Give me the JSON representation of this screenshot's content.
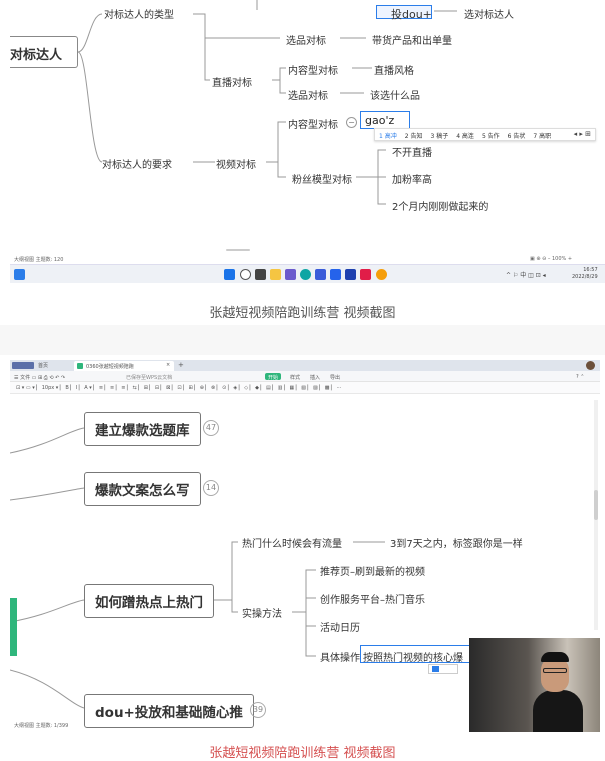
{
  "shot1": {
    "top_notice": "投dou+",
    "root_label": "对标达人",
    "branch_types": "对标达人的类型",
    "branch_requirements": "对标达人的要求",
    "live_benchmark": "直播对标",
    "video_benchmark": "视频对标",
    "content_benchmark_live": "内容型对标",
    "content_benchmark_video": "内容型对标",
    "product_benchmark_1": "选品对标",
    "product_benchmark_2": "选品对标",
    "fans_benchmark": "粉丝模型对标",
    "leaf_douplus": "投dou+",
    "leaf_choose_talent": "选对标达人",
    "leaf_goods_orders": "带货产品和出单量",
    "leaf_live_style": "直播风格",
    "leaf_what_to_sell": "该选什么品",
    "input_text": "gao'z",
    "ime_candidates": [
      "1 高冲",
      "2 告知",
      "3 稿子",
      "4 高连",
      "5 告作",
      "6 告状",
      "7 高职"
    ],
    "leaf_no_live": "不开直播",
    "leaf_high_fans_rate": "加粉率高",
    "leaf_two_months": "2个月内刚刚做起来的",
    "status_left": "大纲视图   主题数: 120",
    "status_zoom": "100%",
    "clock_time": "16:57",
    "clock_date": "2022/8/29"
  },
  "caption1": "张越短视频陪跑训练营 视频截图",
  "shot2": {
    "tab_home": "首页",
    "tab_doc": "0360张越短视频陪跑",
    "toolbar_hint": "已保存至WPS云文档",
    "menu_start": "开始",
    "menu_style": "样式",
    "menu_insert": "插入",
    "menu_export": "导出",
    "node_topic_lib": "建立爆款选题库",
    "badge_topic_lib": "47",
    "node_copywriting": "爆款文案怎么写",
    "badge_copywriting": "14",
    "node_hot_topic": "如何蹭热点上热门",
    "node_douplus": "dou+投放和基础随心推",
    "badge_douplus": "39",
    "sub_when_traffic": "热门什么时候会有流量",
    "leaf_3_to_7_days": "3到7天之内，标签跟你是一样",
    "sub_practice": "实操方法",
    "leaf_recommend": "推荐页–刷到最新的视频",
    "leaf_creator_platform": "创作服务平台–热门音乐",
    "leaf_activity_calendar": "活动日历",
    "leaf_specific_ops": "具体操作",
    "leaf_core_editing": "按照热门视频的核心爆",
    "status_left": "大纲视图   主题数: 1/399"
  },
  "caption2": "张越短视频陪跑训练营 视频截图",
  "colors": {
    "caption2": "#d55050",
    "green_accent": "#2fb67c",
    "input_blue": "#2b7de9"
  }
}
